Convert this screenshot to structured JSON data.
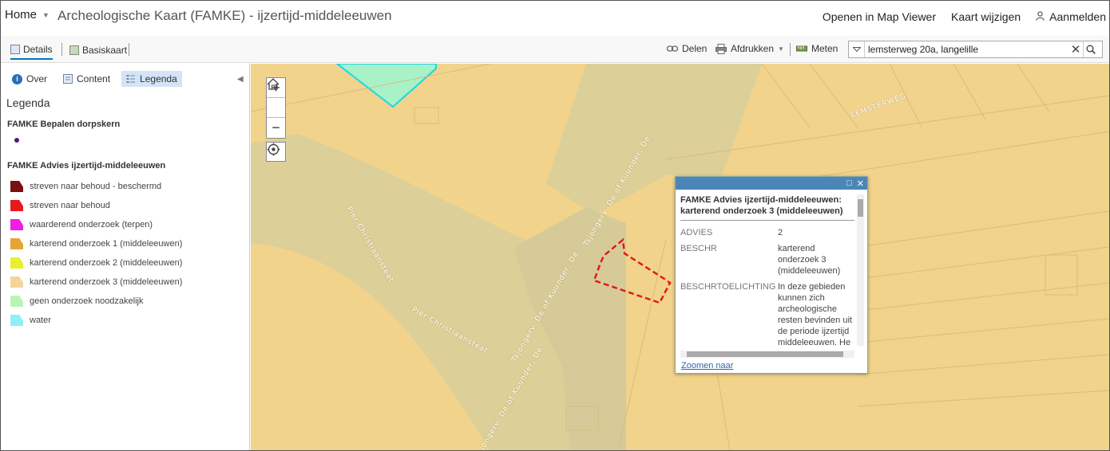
{
  "header": {
    "home_label": "Home",
    "title": "Archeologische Kaart (FAMKE) - ijzertijd-middeleeuwen",
    "links": {
      "open_map_viewer": "Openen in Map Viewer",
      "edit_map": "Kaart wijzigen",
      "sign_in": "Aanmelden"
    }
  },
  "toolbar": {
    "details": "Details",
    "basemap": "Basiskaart",
    "share": "Delen",
    "print": "Afdrukken",
    "measure": "Meten",
    "search_value": "lemsterweg 20a, langelille"
  },
  "panel": {
    "tabs": {
      "about": "Over",
      "content": "Content",
      "legend": "Legenda"
    },
    "legend_heading": "Legenda",
    "layers": [
      {
        "title": "FAMKE Bepalen dorpskern",
        "items": []
      },
      {
        "title": "FAMKE Advies ijzertijd-middeleeuwen",
        "items": [
          {
            "label": "streven naar behoud - beschermd",
            "color": "#7a1010"
          },
          {
            "label": "streven naar behoud",
            "color": "#e8191a"
          },
          {
            "label": "waarderend onderzoek (terpen)",
            "color": "#ee1fe0"
          },
          {
            "label": "karterend onderzoek 1 (middeleeuwen)",
            "color": "#e7a434"
          },
          {
            "label": "karterend onderzoek 2 (middeleeuwen)",
            "color": "#e5f02f"
          },
          {
            "label": "karterend onderzoek 3 (middeleeuwen)",
            "color": "#f3d59a"
          },
          {
            "label": "geen onderzoek noodzakelijk",
            "color": "#b8f5b4"
          },
          {
            "label": "water",
            "color": "#8ef0f4"
          }
        ]
      }
    ]
  },
  "map": {
    "labels": {
      "road1": "LEMSTERWEG",
      "road2": "Pier Christiaansteat",
      "road3": "Pier Christiaansteat",
      "road4": "Tsjongerv. De of Kuunder, De",
      "road5": "Tsjongerv. De of Kuunder, De",
      "road6": "Tsjongerv. De of Kuunder, De"
    },
    "colors": {
      "land": "#f1d38c",
      "channel": "#dccf98",
      "highlight": "#e01b1b",
      "green_area": "#a9f2c8"
    }
  },
  "popup": {
    "title": "FAMKE Advies ijzertijd-middeleeuwen: karterend onderzoek 3 (middeleeuwen)",
    "attributes": [
      {
        "key": "ADVIES",
        "value": "2"
      },
      {
        "key": "BESCHR",
        "value": "karterend onderzoek 3 (middeleeuwen)"
      },
      {
        "key": "BESCHRTOELICHTING",
        "value": "In deze gebieden kunnen zich archeologische resten bevinden uit de periode ijzertijd middeleeuwen. He"
      }
    ],
    "zoom_link": "Zoomen naar"
  }
}
